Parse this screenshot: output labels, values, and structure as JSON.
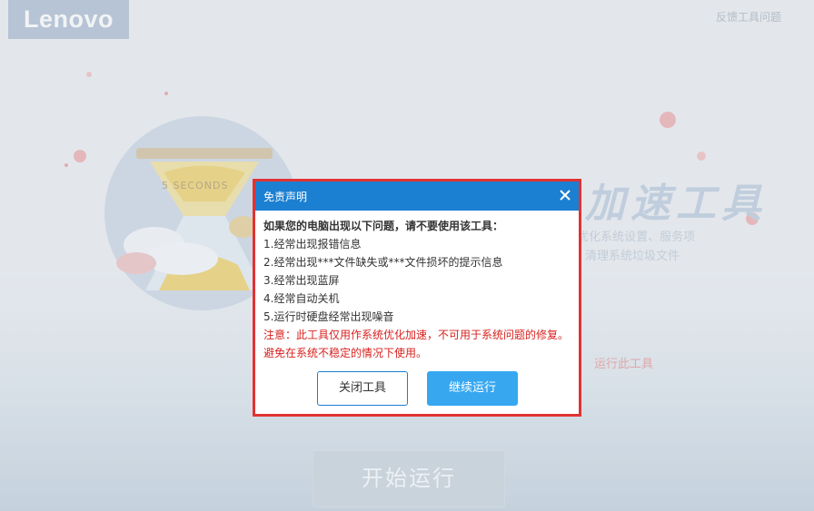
{
  "app": {
    "logo": "Lenovo",
    "feedback_link": "反馈工具问题",
    "background": {
      "title": "加速工具",
      "desc_line1": "包    优化系统设置、服务项",
      "desc_line2": "额、清理系统垃圾文件",
      "warning": "运行此工具",
      "hourglass_label": "5 SECONDS"
    },
    "start_button": "开始运行"
  },
  "dialog": {
    "title": "免责声明",
    "heading": "如果您的电脑出现以下问题，请不要使用该工具：",
    "items": [
      "1.经常出现报错信息",
      "2.经常出现***文件缺失或***文件损坏的提示信息",
      "3.经常出现蓝屏",
      "4.经常自动关机",
      "5.运行时硬盘经常出现噪音"
    ],
    "note_line1": "注意：此工具仅用作系统优化加速，不可用于系统问题的修复。",
    "note_line2": "避免在系统不稳定的情况下使用。",
    "close_button": "关闭工具",
    "continue_button": "继续运行"
  },
  "colors": {
    "dialog_title_bar": "#1b7fd2",
    "highlight_border": "#e03333",
    "continue_button": "#37a7f0",
    "note_text": "#d8221f"
  }
}
